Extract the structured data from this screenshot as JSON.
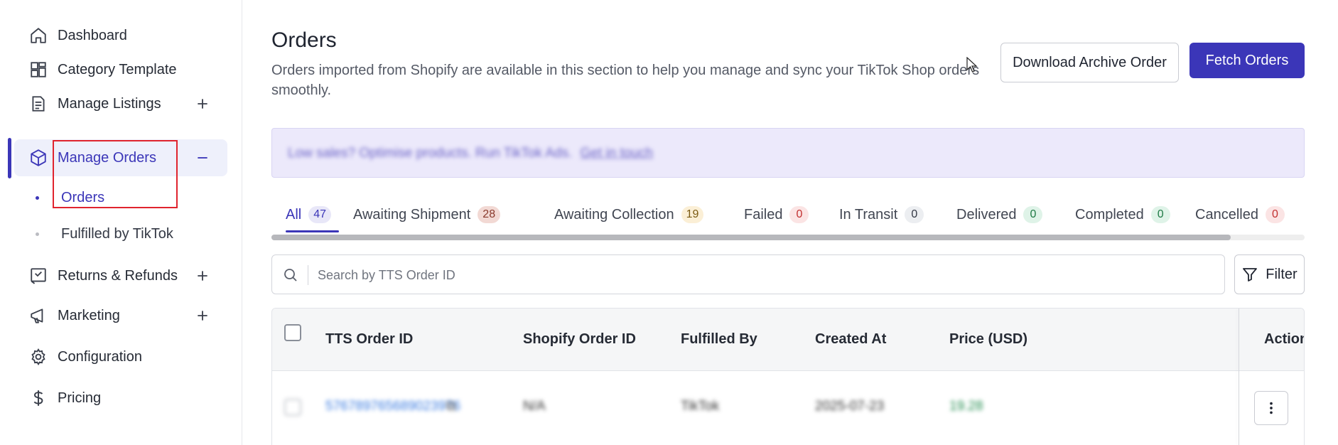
{
  "sidebar": {
    "items": [
      {
        "label": "Dashboard",
        "icon": "home-icon"
      },
      {
        "label": "Category Template",
        "icon": "template-grid-icon"
      },
      {
        "label": "Manage Listings",
        "icon": "document-icon",
        "expand": "+"
      },
      {
        "label": "Manage Orders",
        "icon": "box-icon",
        "expand": "−",
        "active": true
      },
      {
        "label": "Returns & Refunds",
        "icon": "return-icon",
        "expand": "+"
      },
      {
        "label": "Marketing",
        "icon": "megaphone-icon",
        "expand": "+"
      },
      {
        "label": "Configuration",
        "icon": "gear-icon"
      },
      {
        "label": "Pricing",
        "icon": "dollar-icon"
      }
    ],
    "sub_items": [
      {
        "label": "Orders",
        "active": true
      },
      {
        "label": "Fulfilled by TikTok",
        "active": false
      }
    ]
  },
  "header": {
    "title": "Orders",
    "description": "Orders imported from Shopify are available in this section to help you manage and sync your TikTok Shop orders smoothly.",
    "download_label": "Download Archive Order",
    "fetch_label": "Fetch Orders"
  },
  "banner": {
    "text": "Low sales? Optimise products. Run TikTok Ads.",
    "link": "Get in touch"
  },
  "tabs": [
    {
      "label": "All",
      "count": "47",
      "active": true,
      "badge_bg": "#e8e7f8",
      "badge_fg": "#3b36b8"
    },
    {
      "label": "Awaiting Shipment",
      "count": "28",
      "badge_bg": "#f2d9d4",
      "badge_fg": "#8a3a2c"
    },
    {
      "label": "Awaiting Collection",
      "count": "19",
      "badge_bg": "#fbefd6",
      "badge_fg": "#7a5a12"
    },
    {
      "label": "Failed",
      "count": "0",
      "badge_bg": "#fbe4e4",
      "badge_fg": "#c23030"
    },
    {
      "label": "In Transit",
      "count": "0",
      "badge_bg": "#eceef1",
      "badge_fg": "#333844"
    },
    {
      "label": "Delivered",
      "count": "0",
      "badge_bg": "#dff3e8",
      "badge_fg": "#1f7a45"
    },
    {
      "label": "Completed",
      "count": "0",
      "badge_bg": "#dff3e8",
      "badge_fg": "#1f7a45"
    },
    {
      "label": "Cancelled",
      "count": "0",
      "badge_bg": "#fbe4e4",
      "badge_fg": "#c23030"
    }
  ],
  "search": {
    "placeholder": "Search by TTS Order ID",
    "value": ""
  },
  "filter_label": "Filter",
  "table": {
    "columns": [
      "TTS Order ID",
      "Shopify Order ID",
      "Fulfilled By",
      "Created At",
      "Price (USD)",
      "Actions"
    ],
    "rows": [
      {
        "tts_order_id": "576789765689023976",
        "shopify_order_id": "N/A",
        "fulfilled_by": "TikTok",
        "created_at": "2025-07-23",
        "price": "19.28"
      }
    ]
  },
  "colors": {
    "accent": "#3b36b8",
    "highlight": "#e0242e"
  }
}
